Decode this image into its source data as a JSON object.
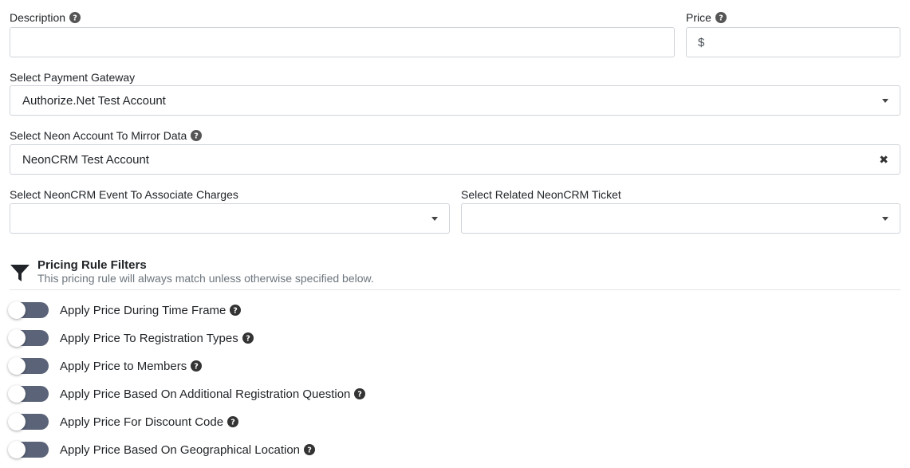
{
  "fields": {
    "description": {
      "label": "Description",
      "value": ""
    },
    "price": {
      "label": "Price",
      "prefix": "$",
      "value": ""
    },
    "payment_gateway": {
      "label": "Select Payment Gateway",
      "value": "Authorize.Net Test Account"
    },
    "neon_account": {
      "label": "Select Neon Account To Mirror Data",
      "value": "NeonCRM Test Account"
    },
    "neon_event": {
      "label": "Select NeonCRM Event To Associate Charges",
      "value": ""
    },
    "neon_ticket": {
      "label": "Select Related NeonCRM Ticket",
      "value": ""
    }
  },
  "pricing_filters": {
    "title": "Pricing Rule Filters",
    "subtitle": "This pricing rule will always match unless otherwise specified below.",
    "items": [
      {
        "label": "Apply Price During Time Frame",
        "enabled": false
      },
      {
        "label": "Apply Price To Registration Types",
        "enabled": false
      },
      {
        "label": "Apply Price to Members",
        "enabled": false
      },
      {
        "label": "Apply Price Based On Additional Registration Question",
        "enabled": false
      },
      {
        "label": "Apply Price For Discount Code",
        "enabled": false
      },
      {
        "label": "Apply Price Based On Geographical Location",
        "enabled": false
      }
    ]
  },
  "icons": {
    "help": "question-circle-icon",
    "filter": "funnel-icon",
    "dropdown": "caret-down-icon",
    "clear": "close-icon"
  }
}
